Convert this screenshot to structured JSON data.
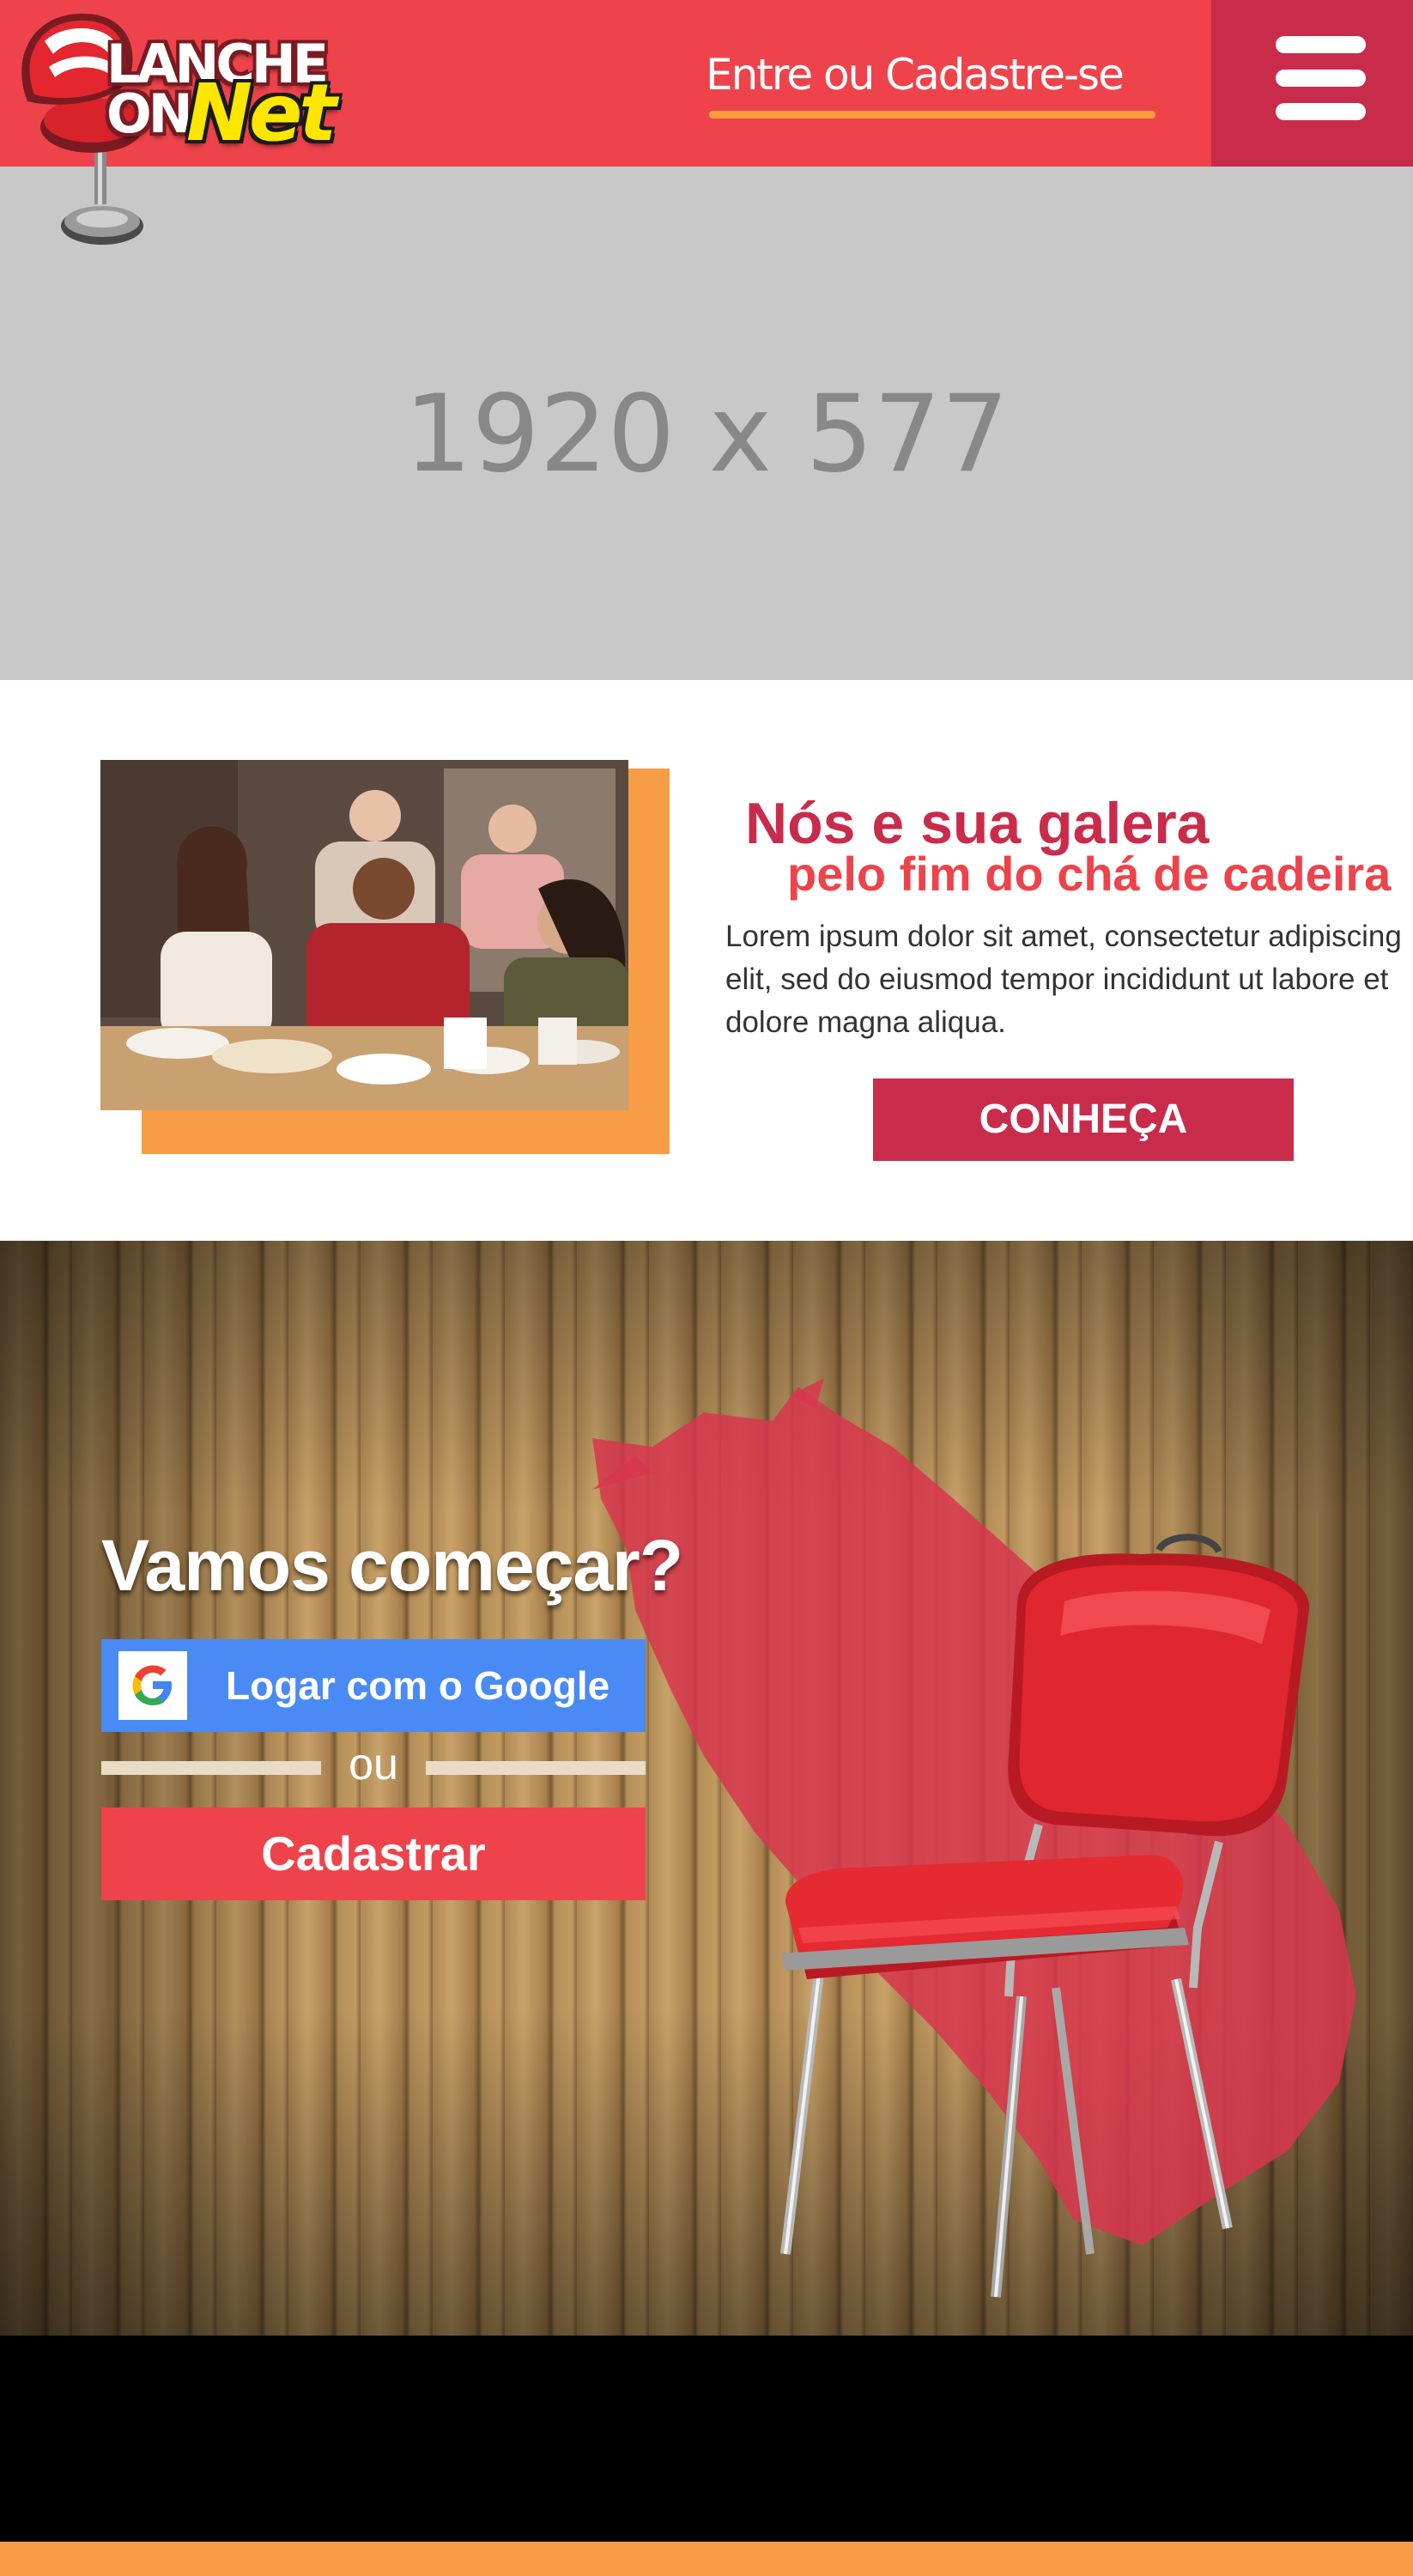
{
  "brand": {
    "logo_line1": "LANCHE",
    "logo_line2": "ON",
    "logo_line3": "Net"
  },
  "header": {
    "login_link": "Entre ou Cadastre-se",
    "menu_icon": "hamburger-icon"
  },
  "hero": {
    "placeholder_text": "1920 x 577"
  },
  "about": {
    "title": "Nós e sua galera",
    "subtitle": "pelo fim do chá de cadeira",
    "body": "Lorem ipsum dolor sit amet, consectetur adipiscing elit, sed do eiusmod tempor incididunt ut labore et dolore magna aliqua.",
    "cta_label": "CONHEÇA"
  },
  "signup": {
    "title": "Vamos começar?",
    "google_label": "Logar com o Google",
    "google_icon": "google-icon",
    "or_text": "ou",
    "register_label": "Cadastrar"
  },
  "colors": {
    "primary_red": "#ee434b",
    "dark_red": "#c92c4b",
    "orange": "#f79d46",
    "google_blue": "#4a8af4"
  }
}
